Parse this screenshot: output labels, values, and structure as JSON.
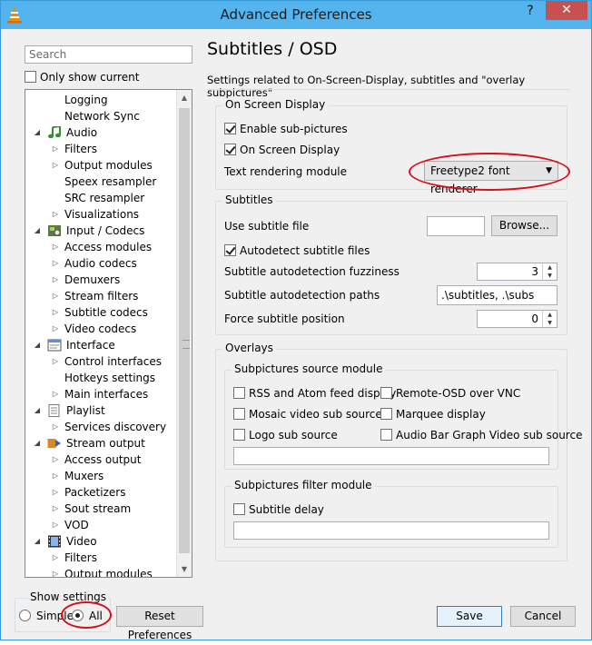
{
  "window": {
    "title": "Advanced Preferences",
    "help_glyph": "?",
    "close_glyph": "✕"
  },
  "left": {
    "search_placeholder": "Search",
    "only_show_current": "Only show current",
    "tree": [
      {
        "label": "Logging",
        "level": 2,
        "arrow": false
      },
      {
        "label": "Network Sync",
        "level": 2,
        "arrow": false
      },
      {
        "label": "Audio",
        "level": 1,
        "arrow": true,
        "icon": "music-note-icon"
      },
      {
        "label": "Filters",
        "level": 2,
        "arrow": true
      },
      {
        "label": "Output modules",
        "level": 2,
        "arrow": true
      },
      {
        "label": "Speex resampler",
        "level": 2,
        "arrow": false
      },
      {
        "label": "SRC resampler",
        "level": 2,
        "arrow": false
      },
      {
        "label": "Visualizations",
        "level": 2,
        "arrow": true
      },
      {
        "label": "Input / Codecs",
        "level": 1,
        "arrow": true,
        "icon": "codec-icon"
      },
      {
        "label": "Access modules",
        "level": 2,
        "arrow": true
      },
      {
        "label": "Audio codecs",
        "level": 2,
        "arrow": true
      },
      {
        "label": "Demuxers",
        "level": 2,
        "arrow": true
      },
      {
        "label": "Stream filters",
        "level": 2,
        "arrow": true
      },
      {
        "label": "Subtitle codecs",
        "level": 2,
        "arrow": true
      },
      {
        "label": "Video codecs",
        "level": 2,
        "arrow": true
      },
      {
        "label": "Interface",
        "level": 1,
        "arrow": true,
        "icon": "interface-icon"
      },
      {
        "label": "Control interfaces",
        "level": 2,
        "arrow": true
      },
      {
        "label": "Hotkeys settings",
        "level": 2,
        "arrow": false
      },
      {
        "label": "Main interfaces",
        "level": 2,
        "arrow": true
      },
      {
        "label": "Playlist",
        "level": 1,
        "arrow": true,
        "icon": "playlist-icon"
      },
      {
        "label": "Services discovery",
        "level": 2,
        "arrow": true
      },
      {
        "label": "Stream output",
        "level": 1,
        "arrow": true,
        "icon": "stream-output-icon"
      },
      {
        "label": "Access output",
        "level": 2,
        "arrow": true
      },
      {
        "label": "Muxers",
        "level": 2,
        "arrow": true
      },
      {
        "label": "Packetizers",
        "level": 2,
        "arrow": true
      },
      {
        "label": "Sout stream",
        "level": 2,
        "arrow": true
      },
      {
        "label": "VOD",
        "level": 2,
        "arrow": true
      },
      {
        "label": "Video",
        "level": 1,
        "arrow": true,
        "icon": "film-icon"
      },
      {
        "label": "Filters",
        "level": 2,
        "arrow": true
      },
      {
        "label": "Output modules",
        "level": 2,
        "arrow": true
      }
    ],
    "show_settings": {
      "legend": "Show settings",
      "simple": "Simple",
      "all": "All",
      "selected": "all"
    },
    "reset_button": "Reset Preferences"
  },
  "right": {
    "title": "Subtitles / OSD",
    "description": "Settings related to On-Screen-Display, subtitles and \"overlay subpictures\"",
    "osd": {
      "legend": "On Screen Display",
      "enable_subpictures": "Enable sub-pictures",
      "on_screen_display": "On Screen Display",
      "text_rendering_label": "Text rendering module",
      "text_rendering_value": "Freetype2 font renderer"
    },
    "subtitles": {
      "legend": "Subtitles",
      "use_subtitle_file": "Use subtitle file",
      "use_subtitle_file_value": "",
      "browse": "Browse...",
      "autodetect": "Autodetect subtitle files",
      "fuzziness_label": "Subtitle autodetection fuzziness",
      "fuzziness_value": "3",
      "paths_label": "Subtitle autodetection paths",
      "paths_value": ".\\subtitles, .\\subs",
      "force_position_label": "Force subtitle position",
      "force_position_value": "0"
    },
    "overlays": {
      "legend": "Overlays",
      "source_legend": "Subpictures source module",
      "rss": "RSS and Atom feed display",
      "remote_osd": "Remote-OSD over VNC",
      "mosaic": "Mosaic video sub source",
      "marquee": "Marquee display",
      "logo": "Logo sub source",
      "audio_bar": "Audio Bar Graph Video sub source",
      "source_value": "",
      "filter_legend": "Subpictures filter module",
      "subtitle_delay": "Subtitle delay",
      "filter_value": ""
    }
  },
  "footer": {
    "save": "Save",
    "cancel": "Cancel"
  },
  "colors": {
    "titlebar": "#54b4ed",
    "close": "#c75050",
    "annotation": "#d4101a"
  }
}
